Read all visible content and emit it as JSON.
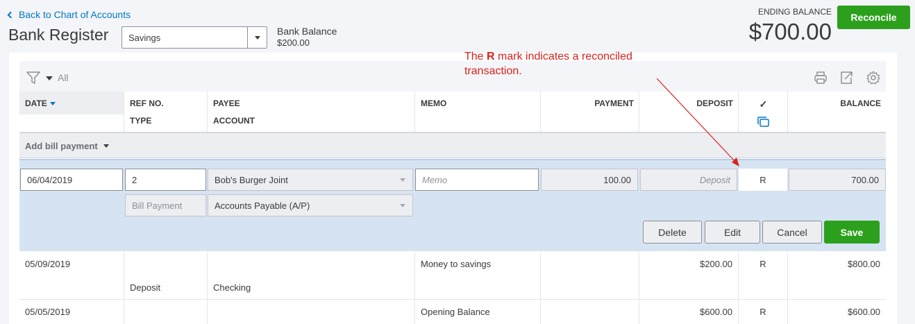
{
  "nav": {
    "back_label": "Back to Chart of Accounts"
  },
  "page": {
    "title": "Bank Register"
  },
  "account_select": {
    "value": "Savings"
  },
  "bank_balance": {
    "label": "Bank Balance",
    "value": "$200.00"
  },
  "ending_balance": {
    "label": "ENDING BALANCE",
    "value": "$700.00"
  },
  "reconcile_button": {
    "label": "Reconcile"
  },
  "annotation": {
    "prefix": "The ",
    "bold": "R",
    "suffix": " mark indicates a reconciled transaction."
  },
  "toolbar": {
    "filter_label": "All",
    "icons": [
      "print-icon",
      "export-icon",
      "gear-icon"
    ]
  },
  "columns": {
    "date": "DATE",
    "ref_no": "REF NO.",
    "type": "TYPE",
    "payee": "PAYEE",
    "account": "ACCOUNT",
    "memo": "MEMO",
    "payment": "PAYMENT",
    "deposit": "DEPOSIT",
    "check": "✓",
    "balance": "BALANCE"
  },
  "add_row": {
    "label": "Add bill payment"
  },
  "edit_row": {
    "date": "06/04/2019",
    "ref_no": "2",
    "payee": "Bob's Burger Joint",
    "memo_placeholder": "Memo",
    "payment": "100.00",
    "deposit_placeholder": "Deposit",
    "reconcile_status": "R",
    "balance": "700.00",
    "type": "Bill Payment",
    "account": "Accounts Payable (A/P)",
    "buttons": {
      "delete": "Delete",
      "edit": "Edit",
      "cancel": "Cancel",
      "save": "Save"
    }
  },
  "rows": [
    {
      "date": "05/09/2019",
      "ref_no": "",
      "payee": "",
      "memo": "Money to savings",
      "payment": "",
      "deposit": "$200.00",
      "status": "R",
      "balance": "$800.00",
      "type": "Deposit",
      "account": "Checking"
    },
    {
      "date": "05/05/2019",
      "ref_no": "",
      "payee": "",
      "memo": "Opening Balance",
      "payment": "",
      "deposit": "$600.00",
      "status": "R",
      "balance": "$600.00"
    }
  ],
  "colors": {
    "accent_green": "#2ca01c",
    "link_blue": "#0077c5",
    "annotation_red": "#d9231b",
    "edit_bg": "#d6e3f2"
  }
}
